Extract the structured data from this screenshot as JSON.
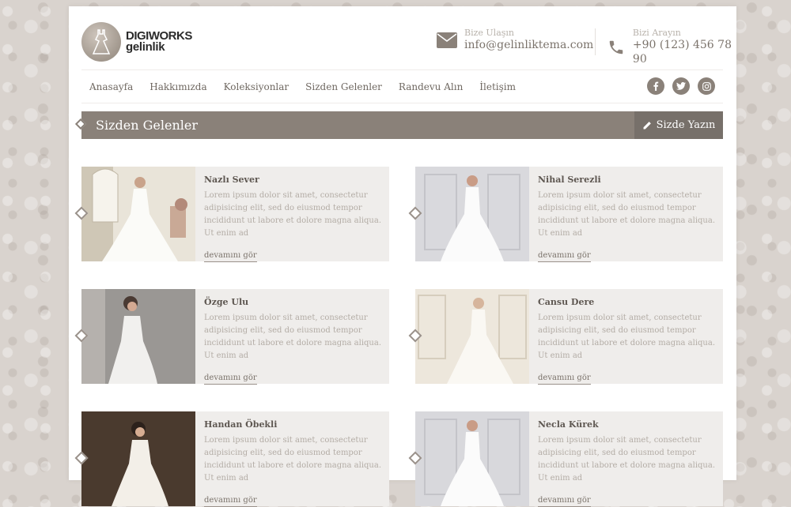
{
  "header": {
    "logo_line1": "DIGIWORKS",
    "logo_line2": "gelinlik",
    "email_label": "Bize Ulaşın",
    "email_value": "info@gelinliktema.com",
    "phone_label": "Bizi Arayın",
    "phone_value": "+90 (123) 456 78 90"
  },
  "nav": {
    "items": [
      "Anasayfa",
      "Hakkımızda",
      "Koleksiyonlar",
      "Sizden Gelenler",
      "Randevu Alın",
      "İletişim"
    ],
    "social": [
      {
        "icon": "facebook-icon",
        "glyph": "f"
      },
      {
        "icon": "twitter-icon",
        "glyph": "t"
      },
      {
        "icon": "instagram-icon",
        "glyph": "◎"
      }
    ]
  },
  "section": {
    "title": "Sizden Gelenler",
    "write_button": "Sizde Yazın"
  },
  "cards": [
    {
      "name": "Nazlı Sever",
      "text": "Lorem ipsum dolor sit amet, consectetur adipisicing elit, sed do eiusmod tempor incididunt ut labore et dolore magna aliqua. Ut enim ad",
      "link": "devamını gör"
    },
    {
      "name": "Nihal Serezli",
      "text": "Lorem ipsum dolor sit amet, consectetur adipisicing elit, sed do eiusmod tempor incididunt ut labore et dolore magna aliqua. Ut enim ad",
      "link": "devamını gör"
    },
    {
      "name": "Özge Ulu",
      "text": "Lorem ipsum dolor sit amet, consectetur adipisicing elit, sed do eiusmod tempor incididunt ut labore et dolore magna aliqua. Ut enim ad",
      "link": "devamını gör"
    },
    {
      "name": "Cansu Dere",
      "text": "Lorem ipsum dolor sit amet, consectetur adipisicing elit, sed do eiusmod tempor incididunt ut labore et dolore magna aliqua. Ut enim ad",
      "link": "devamını gör"
    },
    {
      "name": "Handan Öbekli",
      "text": "Lorem ipsum dolor sit amet, consectetur adipisicing elit, sed do eiusmod tempor incididunt ut labore et dolore magna aliqua. Ut enim ad",
      "link": "devamını gör"
    },
    {
      "name": "Necla Kürek",
      "text": "Lorem ipsum dolor sit amet, consectetur adipisicing elit, sed do eiusmod tempor incididunt ut labore et dolore magna aliqua. Ut enim ad",
      "link": "devamını gör"
    }
  ],
  "colors": {
    "accent": "#8a8179",
    "accent_dark": "#77706a",
    "card_bg": "#efedeb"
  }
}
